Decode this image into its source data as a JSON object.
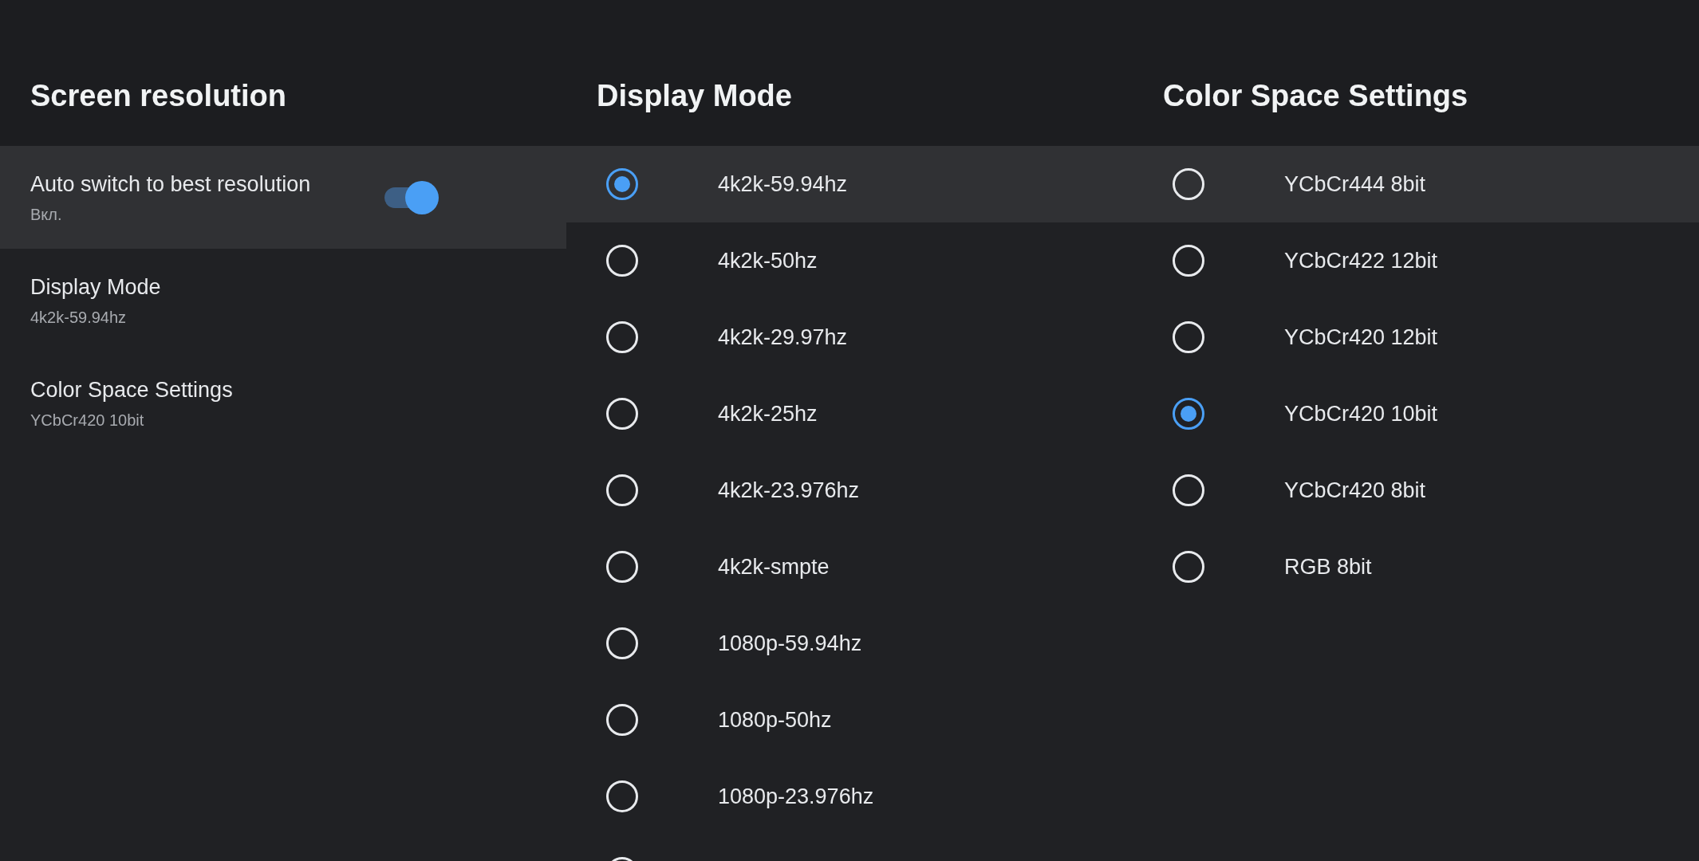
{
  "panels": [
    {
      "kind": "menu",
      "title": "Screen resolution",
      "items": [
        {
          "kind": "toggle",
          "label": "Auto switch to best resolution",
          "value": "Вкл.",
          "on": true,
          "focused": true
        },
        {
          "kind": "link",
          "label": "Display Mode",
          "value": "4k2k-59.94hz",
          "focused": false
        },
        {
          "kind": "link",
          "label": "Color Space Settings",
          "value": "YCbCr420 10bit",
          "focused": false
        }
      ]
    },
    {
      "kind": "radio",
      "title": "Display Mode",
      "options": [
        {
          "label": "4k2k-59.94hz",
          "checked": true,
          "focused": true
        },
        {
          "label": "4k2k-50hz",
          "checked": false,
          "focused": false
        },
        {
          "label": "4k2k-29.97hz",
          "checked": false,
          "focused": false
        },
        {
          "label": "4k2k-25hz",
          "checked": false,
          "focused": false
        },
        {
          "label": "4k2k-23.976hz",
          "checked": false,
          "focused": false
        },
        {
          "label": "4k2k-smpte",
          "checked": false,
          "focused": false
        },
        {
          "label": "1080p-59.94hz",
          "checked": false,
          "focused": false
        },
        {
          "label": "1080p-50hz",
          "checked": false,
          "focused": false
        },
        {
          "label": "1080p-23.976hz",
          "checked": false,
          "focused": false
        },
        {
          "checked": false,
          "focused": false
        }
      ]
    },
    {
      "kind": "radio",
      "title": "Color Space Settings",
      "options": [
        {
          "label": "YCbCr444 8bit",
          "checked": false,
          "focused": true
        },
        {
          "label": "YCbCr422 12bit",
          "checked": false,
          "focused": false
        },
        {
          "label": "YCbCr420 12bit",
          "checked": false,
          "focused": false
        },
        {
          "label": "YCbCr420 10bit",
          "checked": true,
          "focused": false
        },
        {
          "label": "YCbCr420 8bit",
          "checked": false,
          "focused": false
        },
        {
          "label": "RGB 8bit",
          "checked": false,
          "focused": false
        }
      ]
    }
  ]
}
